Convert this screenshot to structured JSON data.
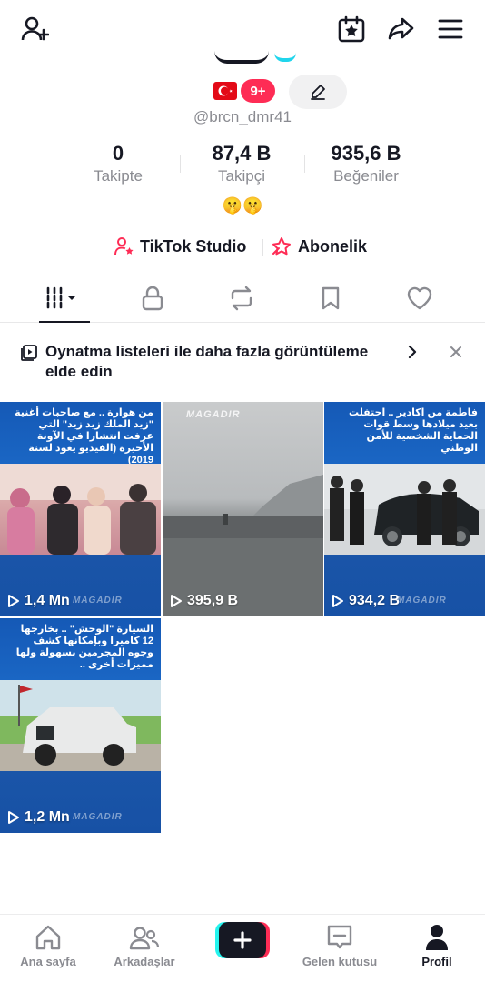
{
  "profile": {
    "notif_count": "9+",
    "username": "@brcn_dmr41",
    "bio": "🤫🤫",
    "stats": [
      {
        "value": "0",
        "label": "Takipte"
      },
      {
        "value": "87,4 B",
        "label": "Takipçi"
      },
      {
        "value": "935,6 B",
        "label": "Beğeniler"
      }
    ],
    "links": {
      "studio": "TikTok Studio",
      "subscription": "Abonelik"
    }
  },
  "banner": {
    "text": "Oynatma listeleri ile daha fazla görüntüleme elde edin"
  },
  "videos": [
    {
      "views": "1,4 Mn",
      "caption": "من هوارة .. مع صاحبات أغنية \"زيد الملك زيد زيد\" التي عرفت انتشارا في الآونة الأخيرة (الفيديو يعود لسنة 2019)",
      "watermark": "MAGADIR"
    },
    {
      "views": "395,9 B",
      "caption": "",
      "watermark": "MAGADIR"
    },
    {
      "views": "934,2 B",
      "caption": "فاطمة من اكادير .. احتفلت بعيد ميلادها وسط قوات الحماية الشخصية للأمن الوطني",
      "watermark": "MAGADIR"
    },
    {
      "views": "1,2 Mn",
      "caption": "السيارة \"الوحش\" .. بخارجها 12 كاميرا وبإمكانها كشف وجوه المجرمين بسهولة ولها مميزات أخرى ..",
      "watermark": "MAGADIR"
    }
  ],
  "nav": {
    "home": "Ana sayfa",
    "friends": "Arkadaşlar",
    "inbox": "Gelen kutusu",
    "profile": "Profil"
  },
  "colors": {
    "accent": "#fe2c55",
    "cyan": "#25f4ee",
    "tile_blue": "#1a55a8"
  }
}
